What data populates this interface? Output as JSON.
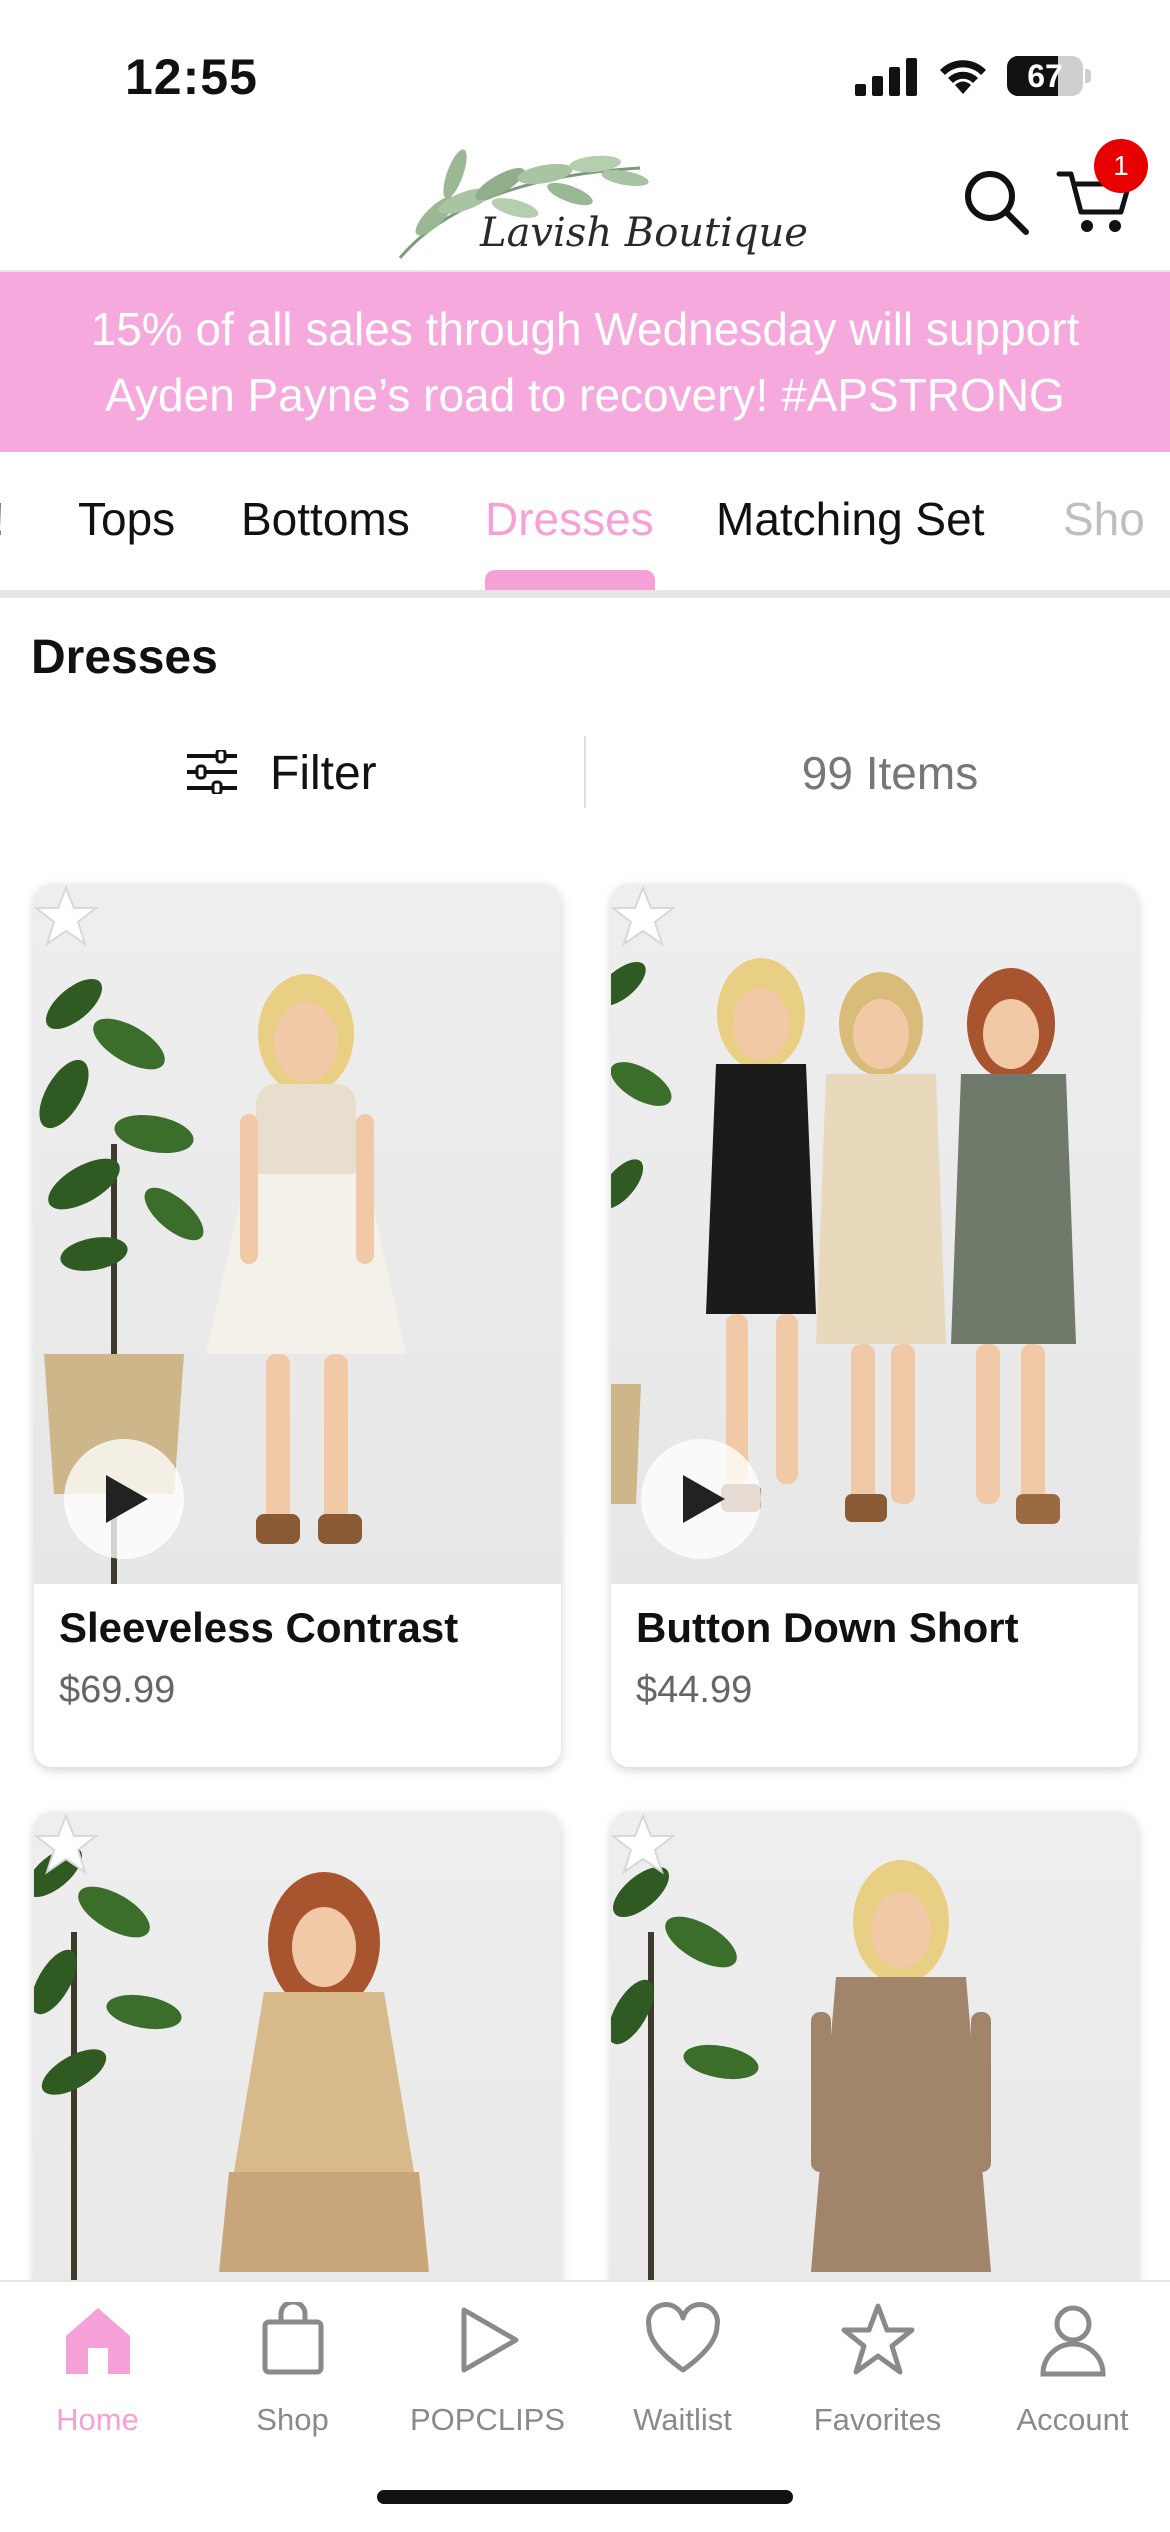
{
  "status_bar": {
    "time": "12:55",
    "battery": "67",
    "battery_level_percent": 67
  },
  "header": {
    "logo_text": "Lavish Boutique",
    "search_icon": "search-icon",
    "cart_icon": "cart-icon",
    "cart_count": "1",
    "cart_badge_color": "#e60000"
  },
  "banner": {
    "text": "15% of all sales through Wednesday will support Ayden Payne’s road to recovery! #APSTRONG",
    "background": "#f5a9dc"
  },
  "tabs": [
    {
      "label": "!"
    },
    {
      "label": "Tops"
    },
    {
      "label": "Bottoms"
    },
    {
      "label": "Dresses"
    },
    {
      "label": "Matching Set"
    },
    {
      "label": "Sho"
    }
  ],
  "accent_color": "#f5a0d6",
  "section": {
    "title": "Dresses"
  },
  "filter": {
    "label": "Filter",
    "icon": "sliders-icon",
    "item_count": "99 Items"
  },
  "products": [
    {
      "name": "Sleeveless Contrast",
      "price": "$69.99",
      "has_video": true
    },
    {
      "name": "Button Down Short",
      "price": "$44.99",
      "has_video": true
    },
    {
      "name": "",
      "price": "",
      "has_video": false
    },
    {
      "name": "",
      "price": "",
      "has_video": false
    }
  ],
  "bottom_nav": [
    {
      "label": "Home",
      "icon": "home-icon",
      "active": true
    },
    {
      "label": "Shop",
      "icon": "shopping-bag-icon",
      "active": false
    },
    {
      "label": "POPCLIPS",
      "icon": "play-icon",
      "active": false
    },
    {
      "label": "Waitlist",
      "icon": "heart-icon",
      "active": false
    },
    {
      "label": "Favorites",
      "icon": "star-icon",
      "active": false
    },
    {
      "label": "Account",
      "icon": "person-icon",
      "active": false
    }
  ]
}
